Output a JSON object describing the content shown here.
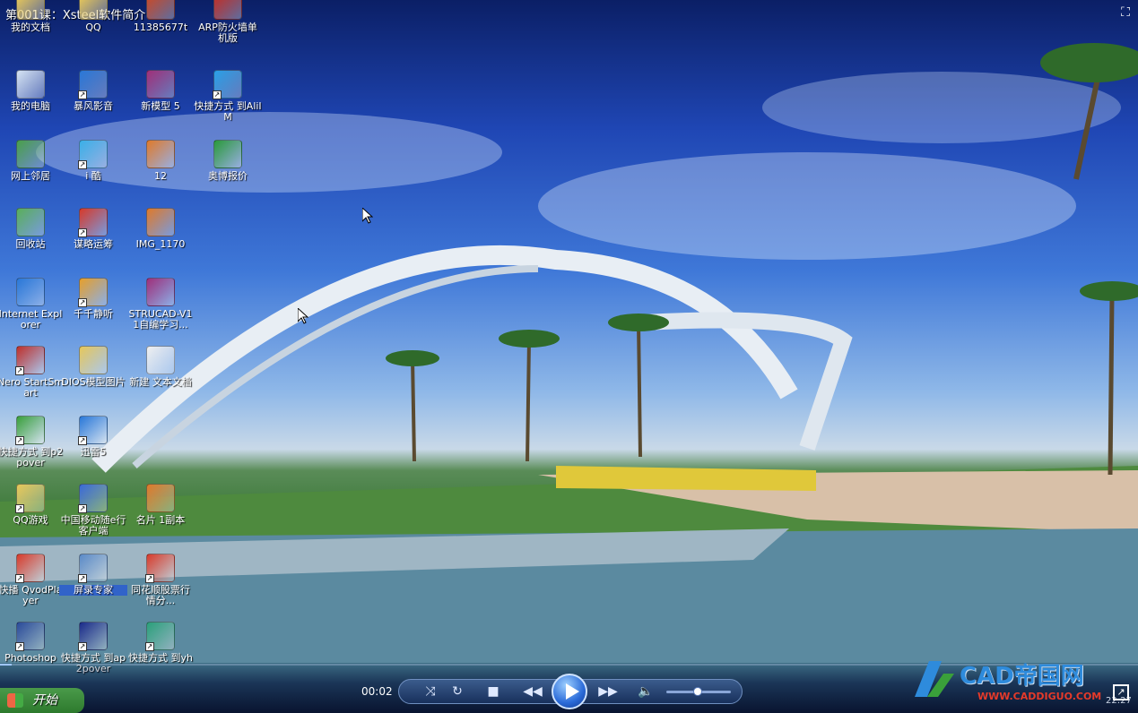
{
  "title": "第001课：Xsteel软件简介",
  "colors": {
    "accent": "#3163c9",
    "sky": "#1f46b4",
    "watermark": "#2e8bdc",
    "watermark_url": "#e53a2a"
  },
  "desktop_icons": [
    {
      "label": "我的文档",
      "icon": "documents-folder-icon",
      "color": "#e8c85a",
      "shortcut": false
    },
    {
      "label": "QQ",
      "icon": "qq-penguin-icon",
      "color": "#e8c85a",
      "shortcut": false
    },
    {
      "label": "11385677t",
      "icon": "image-file-icon",
      "color": "#c94a2a",
      "shortcut": false
    },
    {
      "label": "ARP防火墙单机版",
      "icon": "firewall-shield-icon",
      "color": "#c0302a",
      "shortcut": false
    },
    {
      "label": "我的电脑",
      "icon": "my-computer-icon",
      "color": "#d6e4f4",
      "shortcut": false
    },
    {
      "label": "暴风影音",
      "icon": "storm-player-icon",
      "color": "#2a78d8",
      "shortcut": true
    },
    {
      "label": "新模型 5",
      "icon": "winrar-archive-icon",
      "color": "#a0307a",
      "shortcut": false
    },
    {
      "label": "快捷方式 到AliIM",
      "icon": "aliim-chat-icon",
      "color": "#2aa0e8",
      "shortcut": true
    },
    {
      "label": "网上邻居",
      "icon": "network-places-icon",
      "color": "#4aa04a",
      "shortcut": false
    },
    {
      "label": "i 酷",
      "icon": "play-circle-icon",
      "color": "#3ab0e8",
      "shortcut": true
    },
    {
      "label": "12",
      "icon": "image-file-icon",
      "color": "#e07a2a",
      "shortcut": false
    },
    {
      "label": "奥博报价",
      "icon": "excel-file-icon",
      "color": "#2a9a3a",
      "shortcut": false
    },
    {
      "label": "回收站",
      "icon": "recycle-bin-icon",
      "color": "#5ab05a",
      "shortcut": false
    },
    {
      "label": "谋略运筹",
      "icon": "pdf-file-icon",
      "color": "#d83a2a",
      "shortcut": true
    },
    {
      "label": "IMG_1170",
      "icon": "image-file-icon",
      "color": "#e07a2a",
      "shortcut": false
    },
    {
      "label": "Internet Explorer",
      "icon": "internet-explorer-icon",
      "color": "#2a78d8",
      "shortcut": false
    },
    {
      "label": "千千静听",
      "icon": "ttplayer-icon",
      "color": "#e8a02a",
      "shortcut": true
    },
    {
      "label": "STRUCAD-V11自编学习...",
      "icon": "winrar-archive-icon",
      "color": "#a0307a",
      "shortcut": false
    },
    {
      "label": "Nero StartSmart",
      "icon": "nero-icon",
      "color": "#c0302a",
      "shortcut": true
    },
    {
      "label": "DIOS模型图片",
      "icon": "folder-icon",
      "color": "#e8c85a",
      "shortcut": false
    },
    {
      "label": "新建 文本文档",
      "icon": "text-file-icon",
      "color": "#f0f0f0",
      "shortcut": false
    },
    {
      "label": "快捷方式 到p2pover",
      "icon": "p2pover-icon",
      "color": "#3aa03a",
      "shortcut": true
    },
    {
      "label": "迅雷5",
      "icon": "thunder-download-icon",
      "color": "#2a78d8",
      "shortcut": true
    },
    {
      "label": "QQ游戏",
      "icon": "qq-game-icon",
      "color": "#e8c85a",
      "shortcut": true
    },
    {
      "label": "中国移动随e行客户端",
      "icon": "china-mobile-icon",
      "color": "#3a6ad8",
      "shortcut": true
    },
    {
      "label": "名片 1副本",
      "icon": "image-file-icon",
      "color": "#e07a2a",
      "shortcut": false
    },
    {
      "label": "快播 QvodPlayer",
      "icon": "qvod-player-icon",
      "color": "#d83a2a",
      "shortcut": true
    },
    {
      "label": "屏录专家",
      "icon": "screen-recorder-icon",
      "color": "#5a8ac8",
      "shortcut": true,
      "selected": true
    },
    {
      "label": "同花顺股票行情分...",
      "icon": "stock-cards-icon",
      "color": "#d83a2a",
      "shortcut": true
    },
    {
      "label": "Photoshop",
      "icon": "photoshop-icon",
      "color": "#2a4a9a",
      "shortcut": true
    },
    {
      "label": "快捷方式 到ap2pover",
      "icon": "ap2pover-icon",
      "color": "#1a2a8a",
      "shortcut": true
    },
    {
      "label": "快捷方式 到yh",
      "icon": "yh-shortcut-icon",
      "color": "#2aa07a",
      "shortcut": true
    }
  ],
  "player": {
    "elapsed": "00:02",
    "progress": 0.01,
    "volume": 0.48,
    "buttons": [
      "shuffle-icon",
      "repeat-icon",
      "stop-icon",
      "rewind-icon",
      "play-icon",
      "fast-forward-icon",
      "volume-icon"
    ]
  },
  "taskbar": {
    "start_label": "开始",
    "clock": "22:27"
  },
  "watermark": {
    "text": "CAD帝国网",
    "url": "WWW.CADDIGUO.COM"
  }
}
